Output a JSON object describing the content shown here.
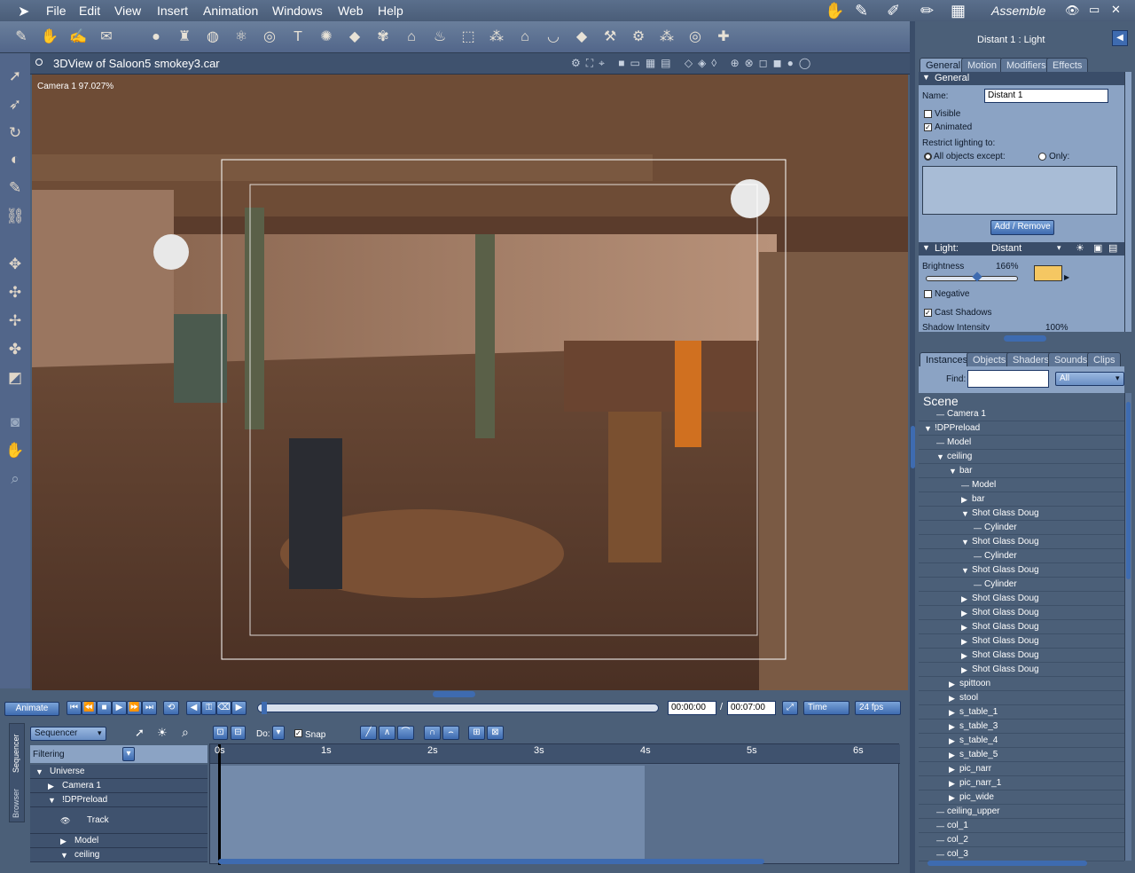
{
  "menu": {
    "items": [
      "File",
      "Edit",
      "View",
      "Insert",
      "Animation",
      "Windows",
      "Web",
      "Help"
    ],
    "room": "Assemble"
  },
  "toolbar_icons": [
    "brush-icon",
    "hand-icon",
    "glove-icon",
    "sheet-icon",
    "sphere-icon",
    "cup-icon",
    "globe-icon",
    "molecule-icon",
    "target-icon",
    "text-icon",
    "gear-icon",
    "plane-icon",
    "palm-icon",
    "hat-icon",
    "flame-icon",
    "box-icon",
    "scatter-icon",
    "house-icon",
    "bowl-icon",
    "rock-icon",
    "hammer-icon",
    "robot-icon",
    "joints-icon",
    "ring-icon",
    "bone-icon"
  ],
  "view": {
    "title": "3DView of Saloon5 smokey3.car",
    "camera_label": "Camera 1 97.027%"
  },
  "right_panel": {
    "title": "Distant 1 : Light",
    "tabs": [
      "General",
      "Motion",
      "Modifiers",
      "Effects"
    ],
    "section_general": "General",
    "name_label": "Name:",
    "name_value": "Distant 1",
    "visible_label": "Visible",
    "animated_label": "Animated",
    "restrict_label": "Restrict lighting to:",
    "all_except_label": "All objects except:",
    "only_label": "Only:",
    "add_remove": "Add / Remove",
    "light_label": "Light:",
    "light_type": "Distant",
    "brightness_label": "Brightness",
    "brightness_value": "166%",
    "brightness_fraction": 0.55,
    "light_color": "#f5c762",
    "negative_label": "Negative",
    "cast_shadows_label": "Cast Shadows",
    "shadow_label": "Shadow Intensity",
    "shadow_value": "100%"
  },
  "browser": {
    "tabs": [
      "Instances",
      "Objects",
      "Shaders",
      "Sounds",
      "Clips"
    ],
    "find_label": "Find:",
    "find_value": "",
    "filter_value": "All",
    "scene_label": "Scene",
    "tree": [
      {
        "label": "Camera 1",
        "indent": 1,
        "toggle": ""
      },
      {
        "label": "!DPPreload",
        "indent": 0,
        "toggle": "open"
      },
      {
        "label": "Model",
        "indent": 1,
        "toggle": ""
      },
      {
        "label": "ceiling",
        "indent": 1,
        "toggle": "open"
      },
      {
        "label": "bar",
        "indent": 2,
        "toggle": "open"
      },
      {
        "label": "Model",
        "indent": 3,
        "toggle": ""
      },
      {
        "label": "bar",
        "indent": 3,
        "toggle": "closed"
      },
      {
        "label": "Shot Glass Doug",
        "indent": 3,
        "toggle": "open"
      },
      {
        "label": "Cylinder",
        "indent": 4,
        "toggle": ""
      },
      {
        "label": "Shot Glass Doug",
        "indent": 3,
        "toggle": "open"
      },
      {
        "label": "Cylinder",
        "indent": 4,
        "toggle": ""
      },
      {
        "label": "Shot Glass Doug",
        "indent": 3,
        "toggle": "open"
      },
      {
        "label": "Cylinder",
        "indent": 4,
        "toggle": ""
      },
      {
        "label": "Shot Glass Doug",
        "indent": 3,
        "toggle": "closed"
      },
      {
        "label": "Shot Glass Doug",
        "indent": 3,
        "toggle": "closed"
      },
      {
        "label": "Shot Glass Doug",
        "indent": 3,
        "toggle": "closed"
      },
      {
        "label": "Shot Glass Doug",
        "indent": 3,
        "toggle": "closed"
      },
      {
        "label": "Shot Glass Doug",
        "indent": 3,
        "toggle": "closed"
      },
      {
        "label": "Shot Glass Doug",
        "indent": 3,
        "toggle": "closed"
      },
      {
        "label": "spittoon",
        "indent": 2,
        "toggle": "closed"
      },
      {
        "label": "stool",
        "indent": 2,
        "toggle": "closed"
      },
      {
        "label": "s_table_1",
        "indent": 2,
        "toggle": "closed"
      },
      {
        "label": "s_table_3",
        "indent": 2,
        "toggle": "closed"
      },
      {
        "label": "s_table_4",
        "indent": 2,
        "toggle": "closed"
      },
      {
        "label": "s_table_5",
        "indent": 2,
        "toggle": "closed"
      },
      {
        "label": "pic_narr",
        "indent": 2,
        "toggle": "closed"
      },
      {
        "label": "pic_narr_1",
        "indent": 2,
        "toggle": "closed"
      },
      {
        "label": "pic_wide",
        "indent": 2,
        "toggle": "closed"
      },
      {
        "label": "ceiling_upper",
        "indent": 1,
        "toggle": ""
      },
      {
        "label": "col_1",
        "indent": 1,
        "toggle": ""
      },
      {
        "label": "col_2",
        "indent": 1,
        "toggle": ""
      },
      {
        "label": "col_3",
        "indent": 1,
        "toggle": ""
      }
    ]
  },
  "timeline": {
    "animate_label": "Animate",
    "time_current": "00:00:00",
    "time_end": "00:07:00",
    "time_mode": "Time",
    "fps": "24 fps",
    "sequencer_label": "Sequencer",
    "do_label": "Do:",
    "snap_label": "Snap",
    "filtering_label": "Filtering",
    "side_tabs": [
      "Sequencer",
      "Browser"
    ],
    "ruler": [
      "0s",
      "1s",
      "2s",
      "3s",
      "4s",
      "5s",
      "6s"
    ],
    "tracks": [
      {
        "label": "Universe",
        "indent": 0,
        "toggle": "open"
      },
      {
        "label": "Camera 1",
        "indent": 1,
        "toggle": "closed"
      },
      {
        "label": "!DPPreload",
        "indent": 1,
        "toggle": "open"
      },
      {
        "label": "Track",
        "indent": 2,
        "toggle": "eye"
      },
      {
        "label": "Model",
        "indent": 2,
        "toggle": "closed"
      },
      {
        "label": "ceiling",
        "indent": 2,
        "toggle": "open"
      }
    ]
  }
}
